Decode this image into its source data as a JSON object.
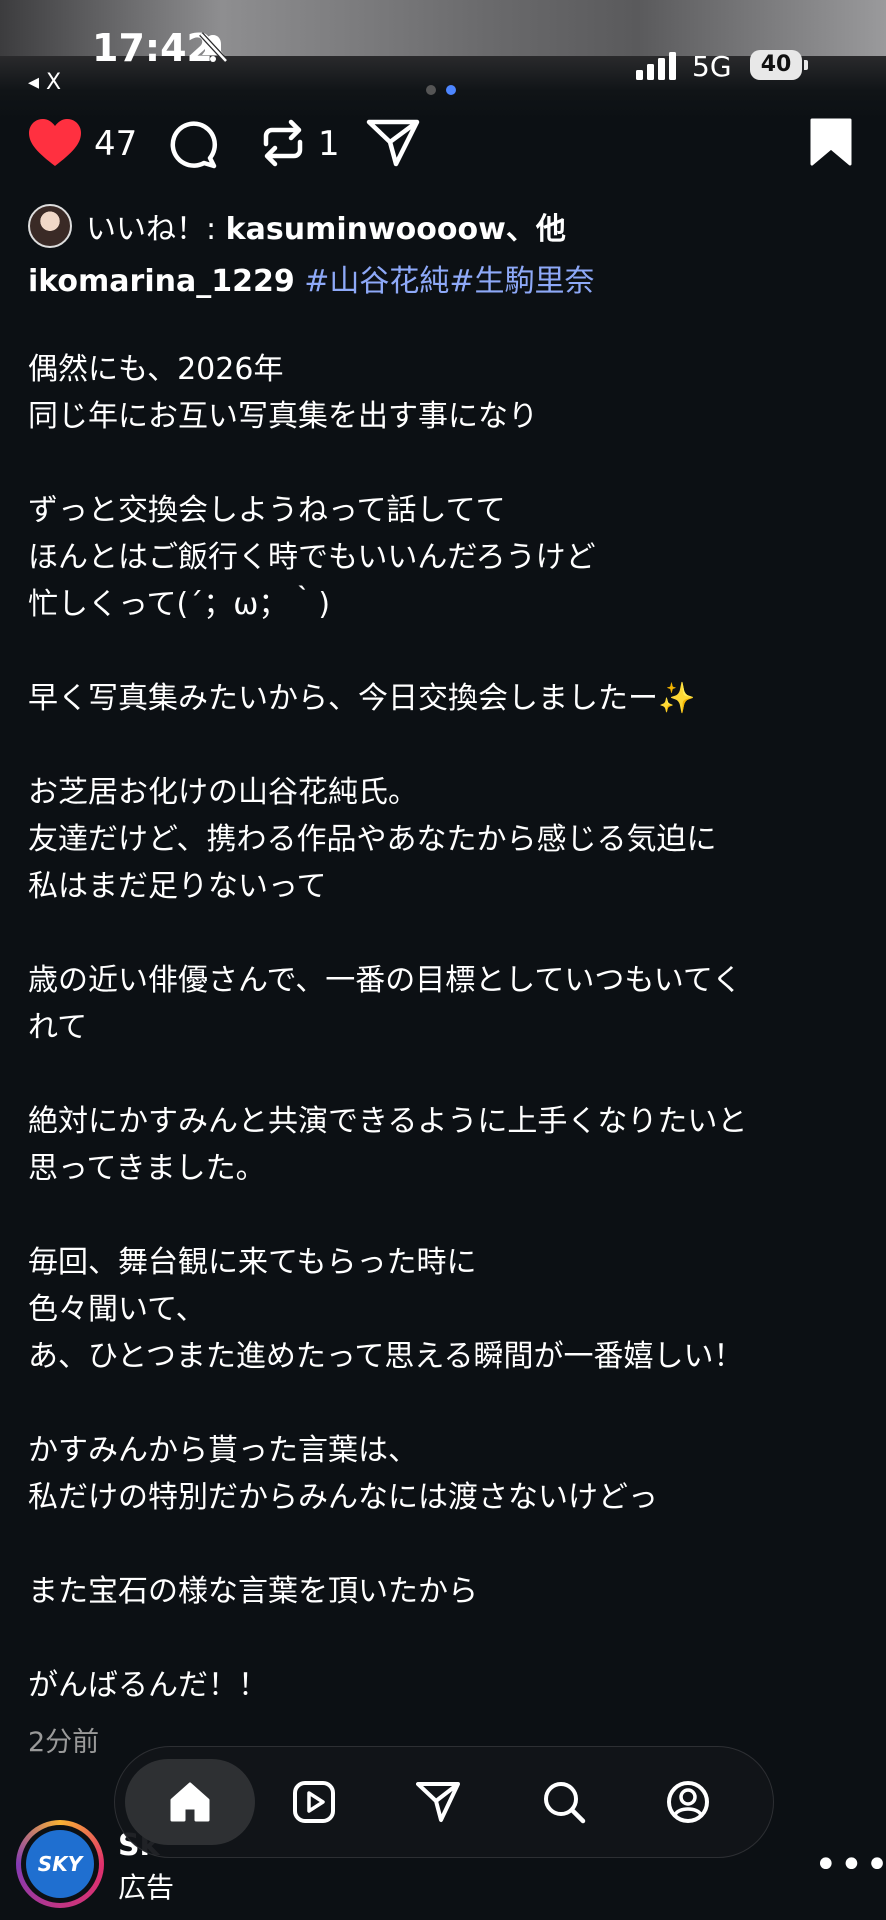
{
  "status_bar": {
    "time": "17:42",
    "back_label": "◂ X",
    "network": "5G",
    "battery": "40"
  },
  "actions": {
    "likes_count": "47",
    "reposts_count": "1"
  },
  "liked_by": {
    "prefix": "いいね！: ",
    "user": "kasuminwoooow、他"
  },
  "post": {
    "username": "ikomarina_1229",
    "tags": " #山谷花純#生駒里奈",
    "lines": [
      "偶然にも、2026年",
      "同じ年にお互い写真集を出す事になり",
      "",
      "ずっと交換会しようねって話してて",
      "ほんとはご飯行く時でもいいんだろうけど",
      "忙しくって(´；ω；｀)",
      "",
      "早く写真集みたいから、今日交換会しましたー✨",
      "",
      "お芝居お化けの山谷花純氏。",
      "友達だけど、携わる作品やあなたから感じる気迫に",
      "私はまだ足りないって",
      "",
      "歳の近い俳優さんで、一番の目標としていつもいてく",
      "れて",
      "",
      "絶対にかすみんと共演できるように上手くなりたいと",
      "思ってきました。",
      "",
      "毎回、舞台観に来てもらった時に",
      "色々聞いて、",
      "あ、ひとつまた進めたって思える瞬間が一番嬉しい！",
      "",
      "かすみんから貰った言葉は、",
      "私だけの特別だからみんなには渡さないけどっ",
      "",
      "また宝石の様な言葉を頂いたから",
      "",
      "がんばるんだ！！"
    ],
    "posted_time": "2分前"
  },
  "sponsored": {
    "logo_text": "SKY",
    "name": "Sk",
    "label": "広告"
  },
  "icons": {
    "heart": "heart-icon",
    "comment": "comment-icon",
    "repost": "repost-icon",
    "share": "send-icon",
    "bookmark": "bookmark-icon",
    "nav": [
      "home-icon",
      "reels-icon",
      "send-icon",
      "search-icon",
      "profile-icon"
    ]
  },
  "colors": {
    "background": "#0c1014",
    "like": "#ff3040",
    "hashtag": "#8ea9f8",
    "accent_dot": "#4d86ff"
  }
}
